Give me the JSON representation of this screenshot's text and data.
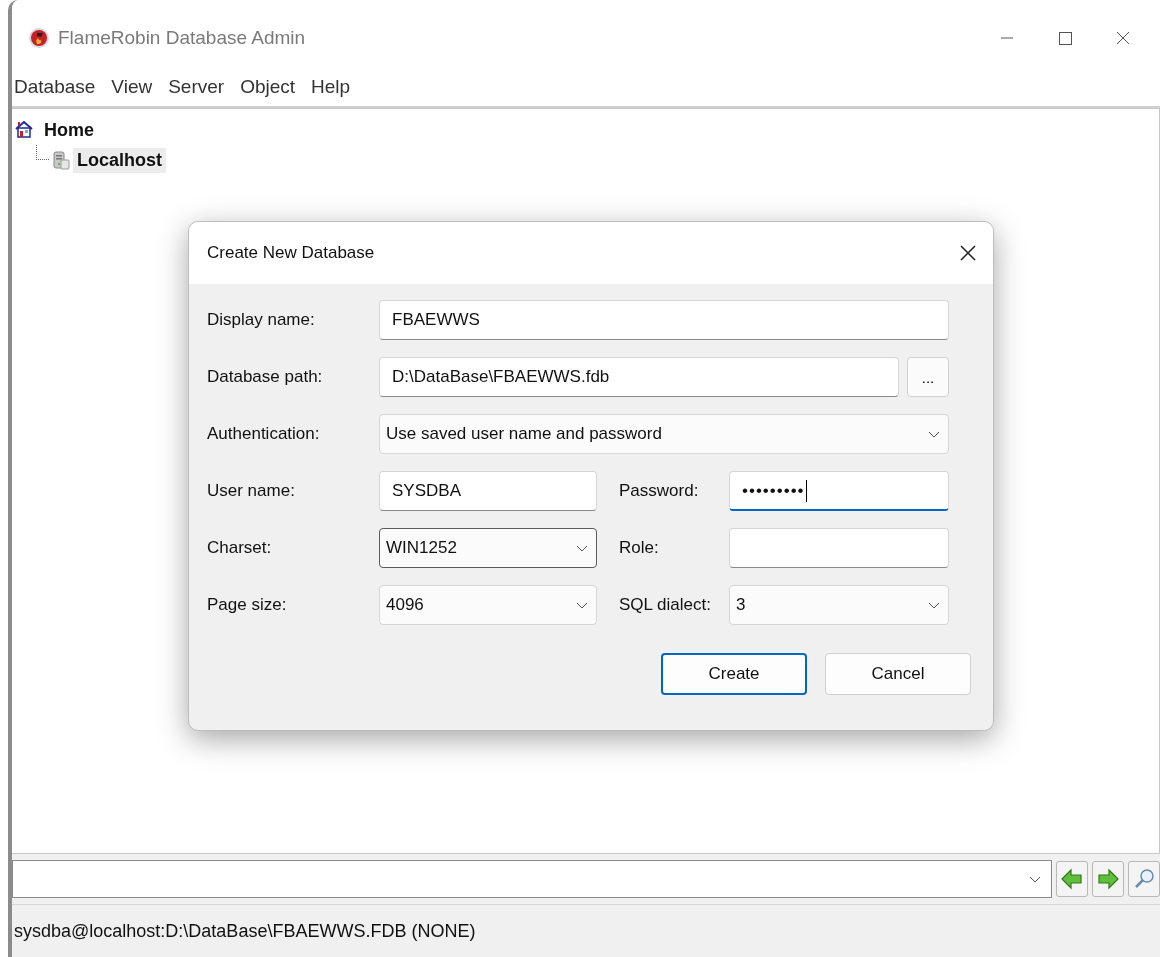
{
  "window": {
    "title": "FlameRobin Database Admin"
  },
  "menu": [
    "Database",
    "View",
    "Server",
    "Object",
    "Help"
  ],
  "tree": [
    {
      "label": "Home",
      "selected": false,
      "children": [
        {
          "label": "Localhost",
          "selected": true
        }
      ]
    }
  ],
  "dialog": {
    "title": "Create New Database",
    "rows": [
      [
        {
          "label": "Display name:",
          "kind": "text",
          "value": "FBAEWWS",
          "focused": false
        }
      ],
      [
        {
          "label": "Database path:",
          "kind": "text",
          "value": "D:\\DataBase\\FBAEWWS.fdb",
          "focused": false,
          "button": "..."
        }
      ],
      [
        {
          "label": "Authentication:",
          "kind": "combo",
          "value": "Use saved user name and password",
          "focused": false
        }
      ],
      [
        {
          "label": "User name:",
          "kind": "text",
          "value": "SYSDBA",
          "focused": false
        },
        {
          "label": "Password:",
          "kind": "password",
          "value": "•••••••••",
          "focused": true
        }
      ],
      [
        {
          "label": "Charset:",
          "kind": "combo",
          "value": "WIN1252",
          "focused": false,
          "hovered": true
        },
        {
          "label": "Role:",
          "kind": "text",
          "focused": false
        }
      ],
      [
        {
          "label": "Page size:",
          "kind": "combo",
          "value": "4096",
          "focused": false
        },
        {
          "label": "SQL dialect:",
          "kind": "combo",
          "value": "3",
          "focused": false
        }
      ]
    ],
    "buttons": [
      {
        "label": "Create",
        "default": true
      },
      {
        "label": "Cancel",
        "default": false
      }
    ]
  },
  "status_bar": "sysdba@localhost:D:\\DataBase\\FBAEWWS.FDB (NONE)"
}
